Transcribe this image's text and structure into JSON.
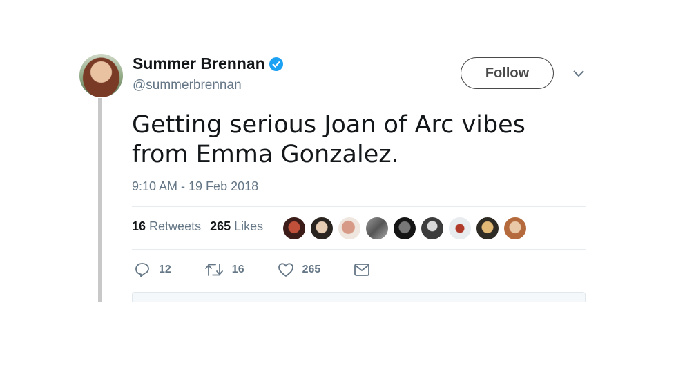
{
  "author": {
    "display_name": "Summer Brennan",
    "handle": "@summerbrennan",
    "verified": true
  },
  "follow_label": "Follow",
  "tweet": {
    "text": "Getting serious Joan of Arc vibes from Emma Gonzalez.",
    "timestamp": "9:10 AM - 19 Feb 2018"
  },
  "stats": {
    "retweets_count": "16",
    "retweets_label": "Retweets",
    "likes_count": "265",
    "likes_label": "Likes"
  },
  "actions": {
    "reply_count": "12",
    "retweet_count": "16",
    "like_count": "265"
  },
  "colors": {
    "verified": "#1da1f2",
    "secondary_text": "#657786",
    "primary_text": "#14171a"
  },
  "icons": [
    "verified-badge-icon",
    "chevron-down-icon",
    "reply-icon",
    "retweet-icon",
    "heart-icon",
    "envelope-icon"
  ]
}
